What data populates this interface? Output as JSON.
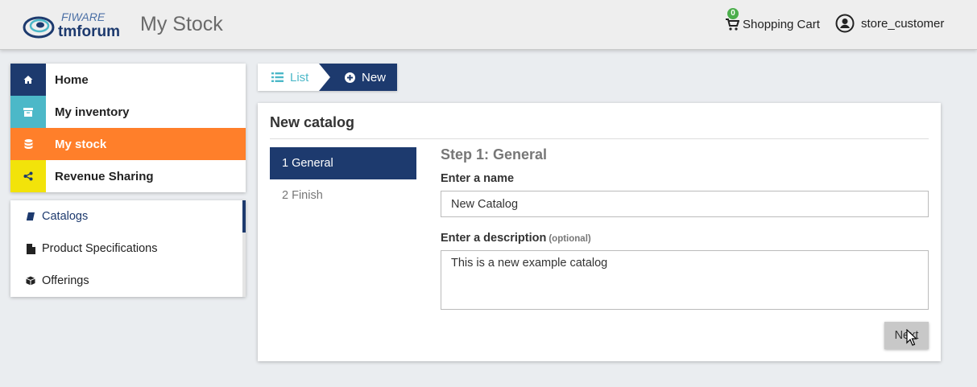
{
  "header": {
    "logo_top": "FIWARE",
    "logo_bottom": "tmforum",
    "title": "My Stock",
    "cart_count": "0",
    "cart_label": "Shopping Cart",
    "user_name": "store_customer"
  },
  "main_menu": [
    {
      "label": "Home",
      "icon": "home-icon",
      "color": "#1d3a6e"
    },
    {
      "label": "My inventory",
      "icon": "archive-icon",
      "color": "#4cb8c8"
    },
    {
      "label": "My stock",
      "icon": "database-icon",
      "color": "#ff7f2a"
    },
    {
      "label": "Revenue Sharing",
      "icon": "share-icon",
      "color": "#f2e30a"
    }
  ],
  "sub_menu": [
    {
      "label": "Catalogs",
      "icon": "book-icon"
    },
    {
      "label": "Product Specifications",
      "icon": "file-icon"
    },
    {
      "label": "Offerings",
      "icon": "cube-icon"
    }
  ],
  "breadcrumb": {
    "list_label": "List",
    "new_label": "New"
  },
  "panel": {
    "title": "New catalog",
    "steps": [
      {
        "label": "1 General"
      },
      {
        "label": "2 Finish"
      }
    ],
    "step_title": "Step 1: General",
    "name_label": "Enter a name",
    "name_value": "New Catalog",
    "desc_label": "Enter a description",
    "desc_optional": "(optional)",
    "desc_value": "This is a new example catalog",
    "next_label": "Next"
  },
  "colors": {
    "primary": "#1d3a6e",
    "accent": "#ff7f2a",
    "teal": "#4cb8c8",
    "yellow": "#f2e30a",
    "badge": "#4cae4c"
  }
}
